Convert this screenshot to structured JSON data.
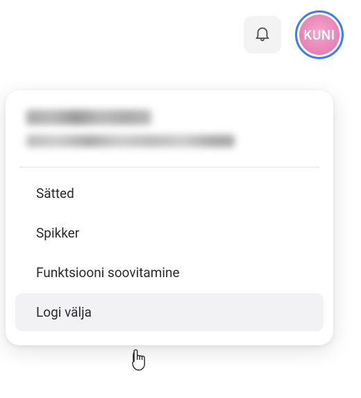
{
  "header": {
    "avatar_text": "KUNI"
  },
  "menu": {
    "items": [
      {
        "label": "Sätted"
      },
      {
        "label": "Spikker"
      },
      {
        "label": "Funktsiooni soovitamine"
      },
      {
        "label": "Logi välja"
      }
    ]
  }
}
